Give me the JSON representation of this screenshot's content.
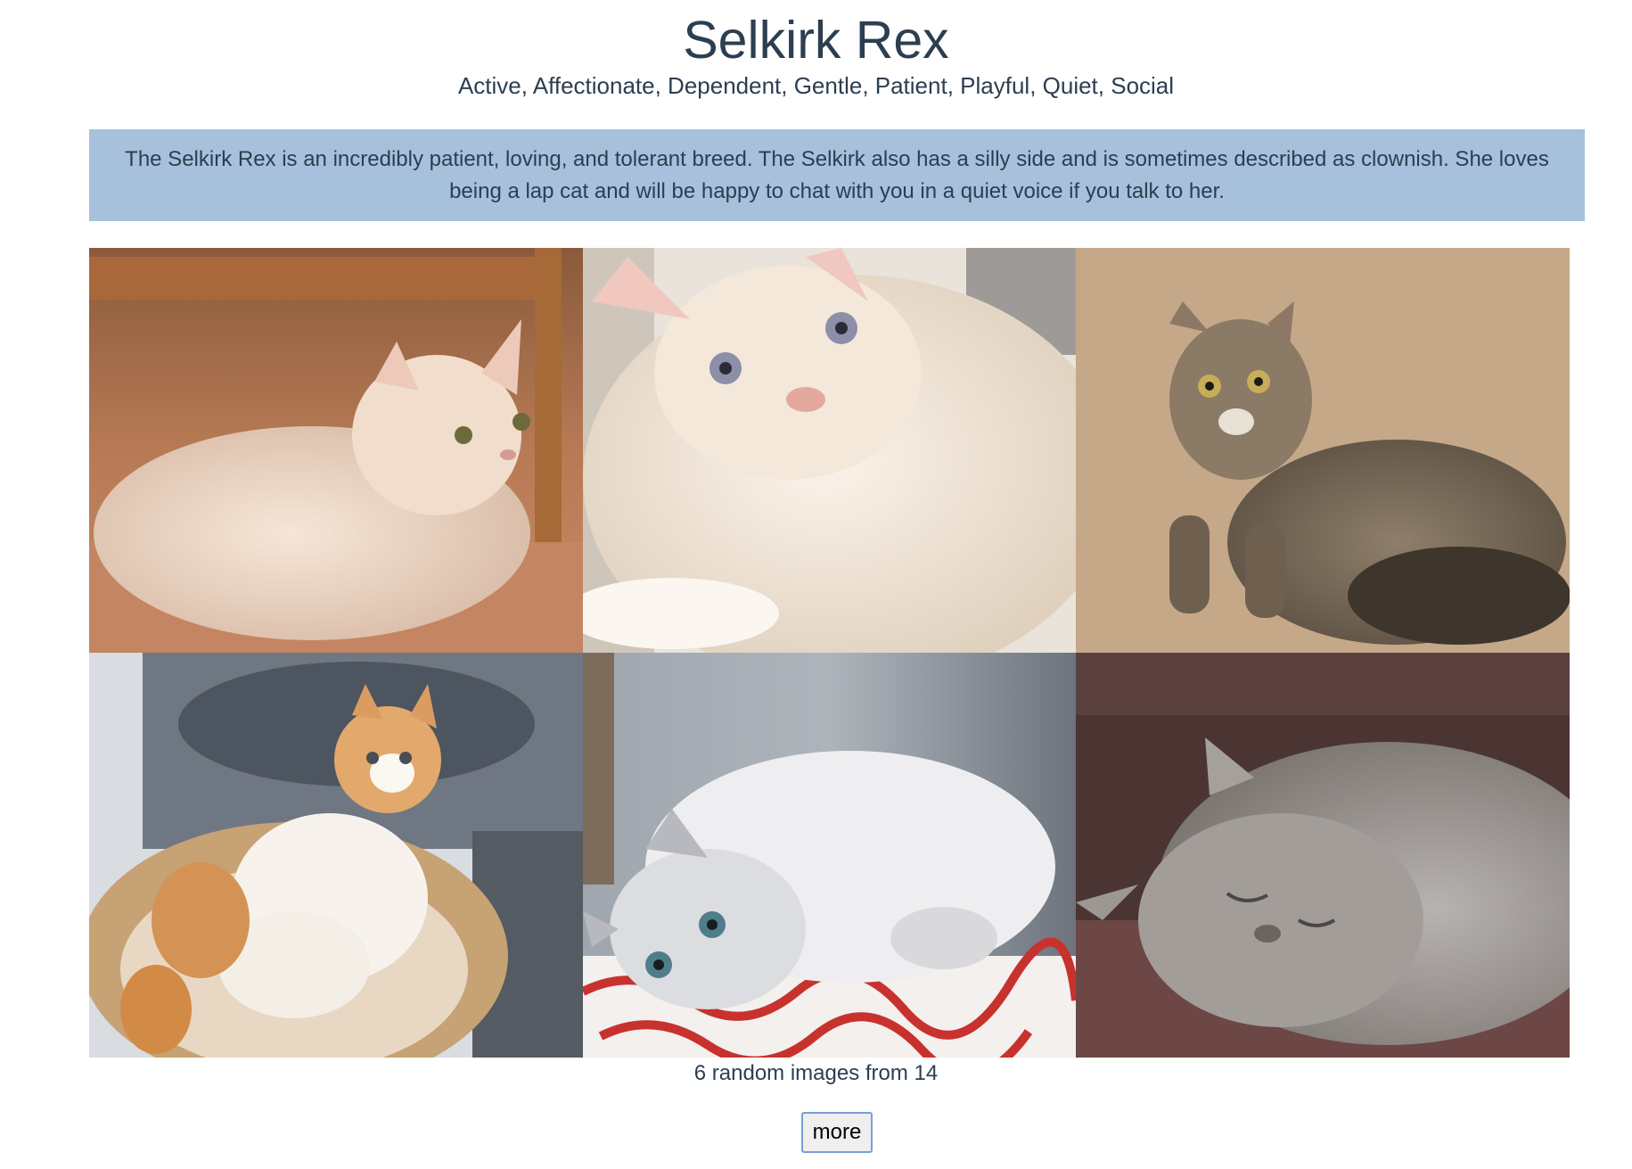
{
  "breed": {
    "name": "Selkirk Rex",
    "temperament": "Active, Affectionate, Dependent, Gentle, Patient, Playful, Quiet, Social",
    "description": "The Selkirk Rex is an incredibly patient, loving, and tolerant breed. The Selkirk also has a silly side and is sometimes described as clownish. She loves being a lap cat and will be happy to chat with you in a quiet voice if you talk to her."
  },
  "gallery": {
    "images": [
      {
        "subject": "cream-kitten-lying-on-floor"
      },
      {
        "subject": "white-fluffy-cat-blue-eyes"
      },
      {
        "subject": "tabby-curly-cat-sitting"
      },
      {
        "subject": "orange-white-kitten-in-basket"
      },
      {
        "subject": "white-kitten-lying-on-blanket"
      },
      {
        "subject": "grey-cat-sleeping"
      }
    ],
    "caption": "6 random images from 14"
  },
  "actions": {
    "more_label": "more"
  },
  "colors": {
    "description_bg": "#a7c0dc",
    "text": "#2c3e50",
    "button_border": "#7a9fd6"
  }
}
